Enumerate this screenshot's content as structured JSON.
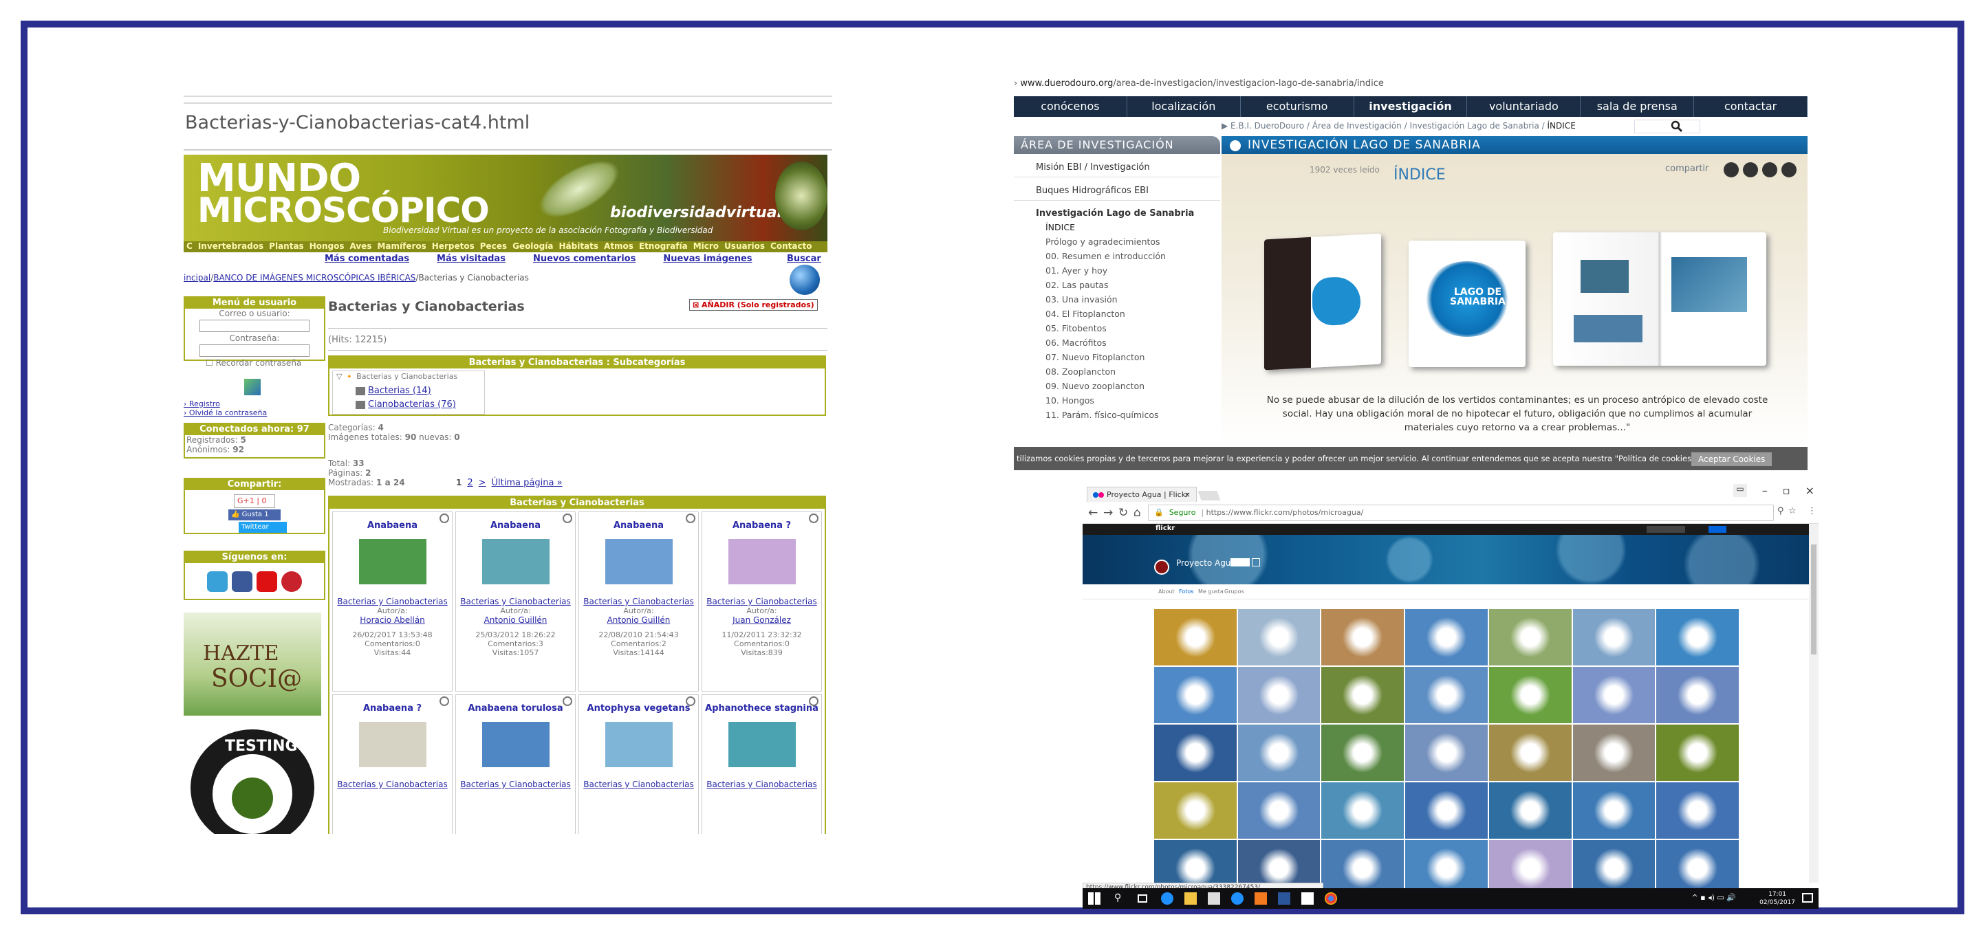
{
  "left": {
    "address_text": "Bacterias-y-Cianobacterias-cat4.html",
    "site_title_1": "MUNDO",
    "site_title_2": "MICROSCÓPICO",
    "banner_site": "biodiversidadvirtual.org",
    "banner_sub": "Biodiversidad Virtual es un proyecto de la asociación Fotografía y Biodiversidad",
    "top_nav": [
      "C",
      "Invertebrados",
      "Plantas",
      "Hongos",
      "Aves",
      "Mamíferos",
      "Herpetos",
      "Peces",
      "Geología",
      "Hábitats",
      "Atmos",
      "Etnografía",
      "Micro",
      "Usuarios",
      "Contacto"
    ],
    "sub_links": [
      "Más comentadas",
      "Más visitadas",
      "Nuevos comentarios",
      "Nuevas imágenes"
    ],
    "search_link": "Buscar",
    "breadcrumb_start": "incipal",
    "breadcrumb_link": "BANCO DE IMÁGENES MICROSCÓPICAS IBÉRICAS",
    "breadcrumb_end": "/Bacterias y Cianobacterias",
    "user_menu": {
      "title": "Menú de usuario",
      "user_label": "Correo o usuario:",
      "pass_label": "Contraseña:",
      "remember": "Recordar contraseña",
      "register": "Registro",
      "forgot": "Olvidé la contraseña"
    },
    "connected": {
      "title": "Conectados ahora: 97",
      "registered_label": "Registrados:",
      "registered": "5",
      "anon_label": "Anónimos:",
      "anon": "92"
    },
    "share": {
      "title": "Compartir:",
      "gplus": "G+1",
      "gplus_count": "0",
      "like": "Gusta",
      "like_count": "1",
      "tweet": "Twittear"
    },
    "follow_title": "Síguenos en:",
    "hazte_1": "HAZTE",
    "hazte_2": "SOCI@",
    "testing_text": "TESTING",
    "main": {
      "title": "Bacterias y Cianobacterias",
      "add_button": "AÑADIR (Solo registrados)",
      "hits": "(Hits: 12215)",
      "subcat_title": "Bacterias y Cianobacterias : Subcategorías",
      "subcat_root": "Bacterias y Cianobacterias",
      "subcats": [
        "Bacterias (14)",
        "Cianobacterias (76)"
      ],
      "categorias_label": "Categorías:",
      "categorias": "4",
      "imagenes_label": "Imágenes totales:",
      "imagenes": "90",
      "nuevas_label": "nuevas:",
      "nuevas": "0",
      "total_label": "Total:",
      "total": "33",
      "paginas_label": "Páginas:",
      "paginas": "2",
      "mostradas_label": "Mostradas:",
      "mostradas": "1 a 24",
      "pager": [
        "1",
        "2",
        ">",
        "Última página »"
      ],
      "grid_title": "Bacterias y Cianobacterias",
      "cards": [
        {
          "name": "Anabaena",
          "cat": "Bacterias y Cianobacterias",
          "autor_label": "Autor/a:",
          "autor": "Horacio Abellán",
          "date": "26/02/2017 13:53:48",
          "coment": "Comentarios:0",
          "visitas": "Visitas:44",
          "color": "#4c9a4a"
        },
        {
          "name": "Anabaena",
          "cat": "Bacterias y Cianobacterias",
          "autor_label": "Autor/a:",
          "autor": "Antonio Guillén",
          "date": "25/03/2012 18:26:22",
          "coment": "Comentarios:3",
          "visitas": "Visitas:1057",
          "color": "#5fa7b5"
        },
        {
          "name": "Anabaena",
          "cat": "Bacterias y Cianobacterias",
          "autor_label": "Autor/a:",
          "autor": "Antonio Guillén",
          "date": "22/08/2010 21:54:43",
          "coment": "Comentarios:2",
          "visitas": "Visitas:14144",
          "color": "#6d9fd4"
        },
        {
          "name": "Anabaena ?",
          "cat": "Bacterias y Cianobacterias",
          "autor_label": "Autor/a:",
          "autor": "Juan González",
          "date": "11/02/2011 23:32:32",
          "coment": "Comentarios:0",
          "visitas": "Visitas:839",
          "color": "#c7a8d9"
        },
        {
          "name": "Anabaena ?",
          "cat": "Bacterias y Cianobacterias",
          "color": "#d7d3c4"
        },
        {
          "name": "Anabaena torulosa",
          "cat": "Bacterias y Cianobacterias",
          "color": "#4f86c4"
        },
        {
          "name": "Antophysa vegetans",
          "cat": "Bacterias y Cianobacterias",
          "color": "#7fb6d8"
        },
        {
          "name": "Aphanothece stagnina",
          "cat": "Bacterias y Cianobacterias",
          "color": "#4ba2b1"
        }
      ]
    }
  },
  "rtop": {
    "url_host": "www.duerodouro.org",
    "url_path": "/area-de-investigacion/investigacion-lago-de-sanabria/indice",
    "nav": [
      "conócenos",
      "localización",
      "ecoturismo",
      "investigación",
      "voluntariado",
      "sala de prensa",
      "contactar"
    ],
    "breadcrumb": "▶ E.B.I. DueroDouro  /  Área de Investigación  /  Investigación Lago de Sanabria /",
    "breadcrumb_current": "ÍNDICE",
    "left_header": "ÁREA DE INVESTIGACIÓN",
    "left_items_top": [
      "Misión EBI / Investigación",
      "Buques Hidrográficos EBI",
      "Investigación Lago de Sanabria"
    ],
    "left_subitems": [
      "ÍNDICE",
      "Prólogo y agradecimientos",
      "00. Resumen e introducción",
      "01. Ayer y hoy",
      "02. Las pautas",
      "03. Una invasión",
      "04. El Fitoplancton",
      "05. Fitobentos",
      "06. Macrófitos",
      "07. Nuevo Fitoplancton",
      "08. Zooplancton",
      "09. Nuevo zooplancton",
      "10. Hongos",
      "11. Parám. físico-químicos"
    ],
    "section_header": "INVESTIGACIÓN LAGO DE SANABRIA",
    "views": "1902 veces leído",
    "indice": "ÍNDICE",
    "share_label": "compartir",
    "quote": "No se puede abusar de la dilución de los vertidos contaminantes; es un proceso antrópico de elevado coste social. Hay una obligación moral de no hipotecar el futuro, obligación que no cumplimos al acumular materiales cuyo retorno va a crear problemas...\"",
    "book_title_1": "LAGO DE",
    "book_title_2": "SANABRIA",
    "cookie_text": "tilizamos cookies propias y de terceros para mejorar la experiencia y poder ofrecer un mejor servicio. Al continuar entendemos que se acepta nuestra \"Política de cookies.\"",
    "cookie_button": "Aceptar Cookies"
  },
  "rbot": {
    "tab_title": "Proyecto Agua | Flickr",
    "secure_label": "Seguro",
    "url": "https://www.flickr.com/photos/microagua/",
    "flickr_logo": "flickr",
    "profile_name": "Proyecto Agua",
    "subnav": [
      "About",
      "Fotos",
      "Me gusta",
      "Grupos"
    ],
    "status_url": "https://www.flickr.com/photos/microagua/33382267453/",
    "clock_time": "17:01",
    "clock_date": "02/05/2017",
    "photo_colors": [
      "#c4962f",
      "#9fb7cf",
      "#b78a55",
      "#4f87c2",
      "#8faa6a",
      "#7ea3c8",
      "#3d88c4",
      "#4f89c7",
      "#8ea6cc",
      "#6f8a3b",
      "#5d8ec4",
      "#69a23f",
      "#7b93c9",
      "#6a87c0",
      "#2f5c97",
      "#6f98c4",
      "#5b8a46",
      "#7591bd",
      "#a28e4a",
      "#90877a",
      "#6e8b2c",
      "#b2a53a",
      "#5a86bd",
      "#4e90b8",
      "#3d6fb0",
      "#2f6ea0",
      "#3d7ab6",
      "#4272b4",
      "#2f6496",
      "#3d5f8e",
      "#4a7cb4",
      "#4a86c0",
      "#b2a2d0",
      "#386fa8",
      "#3d72b0"
    ]
  }
}
